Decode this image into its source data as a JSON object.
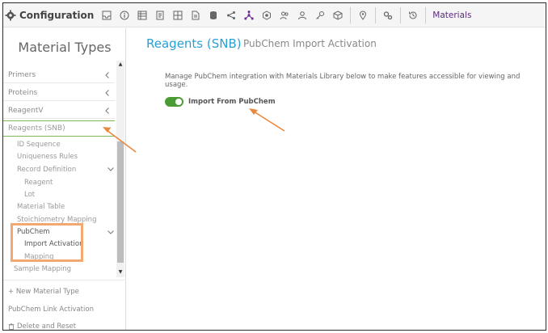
{
  "toolbar": {
    "title": "Configuration",
    "materials_label": "Materials",
    "icons": [
      "inbox-icon",
      "info-icon",
      "table-icon",
      "form-icon",
      "grid-icon",
      "document-icon",
      "database-icon",
      "share-icon",
      "hierarchy-icon",
      "hexagon-icon",
      "users-icon",
      "person-icon",
      "key-icon",
      "cube-icon",
      "location-pin-icon",
      "settings-gears-icon",
      "history-icon"
    ]
  },
  "sidebar": {
    "title": "Material Types",
    "items": [
      {
        "label": "Primers"
      },
      {
        "label": "Proteins"
      },
      {
        "label": "ReagentV"
      },
      {
        "label": "Reagents (SNB)"
      }
    ],
    "sub_items": [
      {
        "label": "ID Sequence"
      },
      {
        "label": "Uniqueness Rules"
      },
      {
        "label": "Record Definition"
      },
      {
        "label": "Reagent"
      },
      {
        "label": "Lot"
      },
      {
        "label": "Material Table"
      },
      {
        "label": "Stoichiometry Mapping"
      },
      {
        "label": "PubChem"
      },
      {
        "label": "Import Activation"
      },
      {
        "label": "Mapping"
      },
      {
        "label": "Sample Mapping"
      }
    ],
    "new_material_type": "+ New Material Type",
    "pubchem_link": "PubChem Link Activation",
    "delete_reset": "Delete and Reset"
  },
  "main": {
    "title": "Reagents (SNB)",
    "subtitle": "PubChem Import Activation",
    "description": "Manage PubChem integration with Materials Library below to make features accessible for viewing and usage.",
    "toggle": {
      "label": "Import From PubChem",
      "on": true
    }
  },
  "colors": {
    "accent_blue": "#2a9fd6",
    "toggle_green": "#4a9b34",
    "highlight_orange": "#f2a872",
    "arrow_orange": "#e9883c",
    "active_border_green": "#7dbb5a"
  }
}
